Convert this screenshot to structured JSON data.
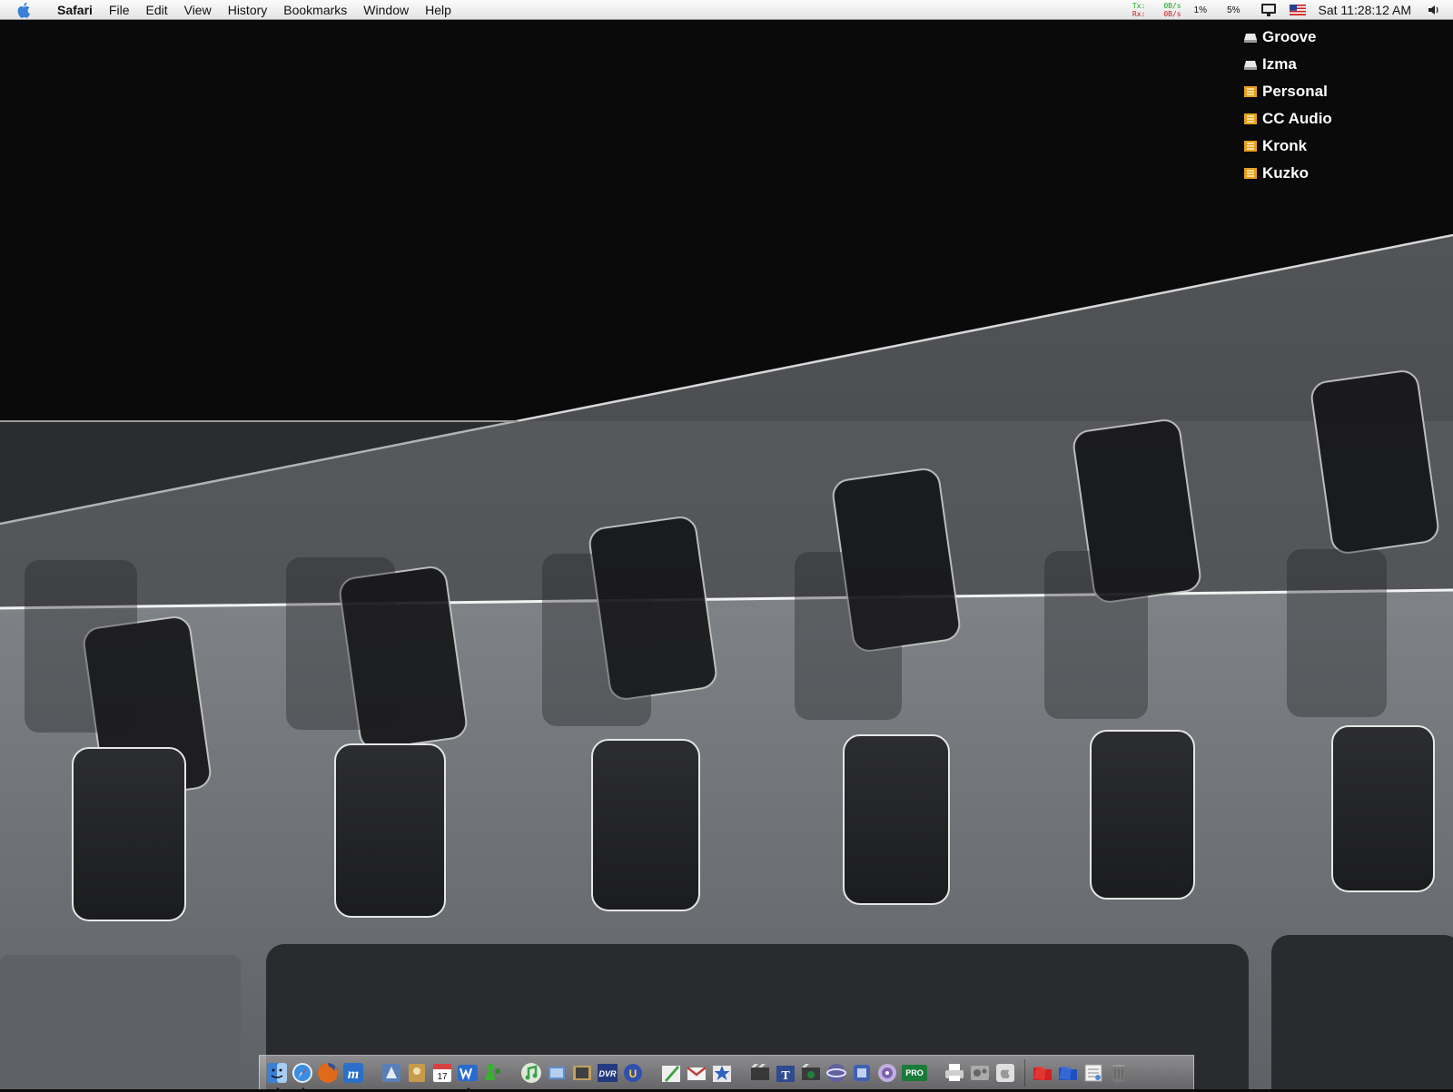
{
  "menubar": {
    "app_name": "Safari",
    "menus": [
      "File",
      "Edit",
      "View",
      "History",
      "Bookmarks",
      "Window",
      "Help"
    ],
    "right": {
      "tx_label": "Tx:",
      "rx_label": "Rx:",
      "tx_value": "0B/s",
      "rx_value": "0B/s",
      "cpu_1": "1%",
      "cpu_2": "5%",
      "clock": "Sat 11:28:12 AM"
    }
  },
  "desktop": {
    "volumes": [
      {
        "name": "Groove",
        "icon": "hard-drive-icon"
      },
      {
        "name": "Izma",
        "icon": "hard-drive-icon"
      },
      {
        "name": "Personal",
        "icon": "firewire-drive-icon"
      },
      {
        "name": "CC Audio",
        "icon": "firewire-drive-icon"
      },
      {
        "name": "Kronk",
        "icon": "firewire-drive-icon"
      },
      {
        "name": "Kuzko",
        "icon": "firewire-drive-icon"
      }
    ]
  },
  "dock": {
    "icons": [
      "finder-icon",
      "safari-icon",
      "firefox-icon",
      "dreamweaver-icon",
      "mail-icon",
      "address-book-icon",
      "ical-icon",
      "word-icon",
      "messenger-icon",
      "itunes-icon",
      "iphoto-icon",
      "imovie-icon",
      "dvr-icon",
      "unreal-icon",
      "pen-icon",
      "mail-alt-icon",
      "star-icon",
      "final-cut-icon",
      "type-icon",
      "soundtrack-icon",
      "motion-icon",
      "compressor-icon",
      "dvd-studio-icon",
      "protools-icon",
      "printer-icon",
      "system-prefs-icon",
      "apple-icon",
      "folder-red-icon",
      "folder-blue-icon",
      "document-icon",
      "trash-icon"
    ],
    "colors": {
      "finder": "#3c7fd4",
      "safari": "#3a8de0",
      "firefox": "#e06a1a",
      "dreamweaver": "#2a70c8",
      "mail": "#5a7fb8",
      "address": "#c79b4a",
      "ical": "#d84040",
      "word": "#2a6ad0",
      "messenger": "#38b030",
      "itunes": "#3fa04a",
      "iphoto": "#5b8fd0",
      "imovie": "#c0a060",
      "dvr": "#243a80",
      "unreal": "#3050b0",
      "pen": "#40a040",
      "mailalt": "#c04040",
      "star": "#3060c0",
      "fcp": "#383838",
      "type": "#304a90",
      "soundtrack": "#208040",
      "motion": "#6060a0",
      "compressor": "#4060b0",
      "dvdsp": "#8060b0",
      "protools": "#1a7a3a",
      "printer": "#dddddd",
      "prefs": "#888888",
      "appleicon": "#bbbbbb",
      "folderred": "#d02020",
      "folderblue": "#2050c0",
      "document": "#e8e8e8",
      "trash": "#7a7a7a"
    },
    "running": [
      "finder-icon",
      "safari-icon",
      "word-icon"
    ]
  }
}
